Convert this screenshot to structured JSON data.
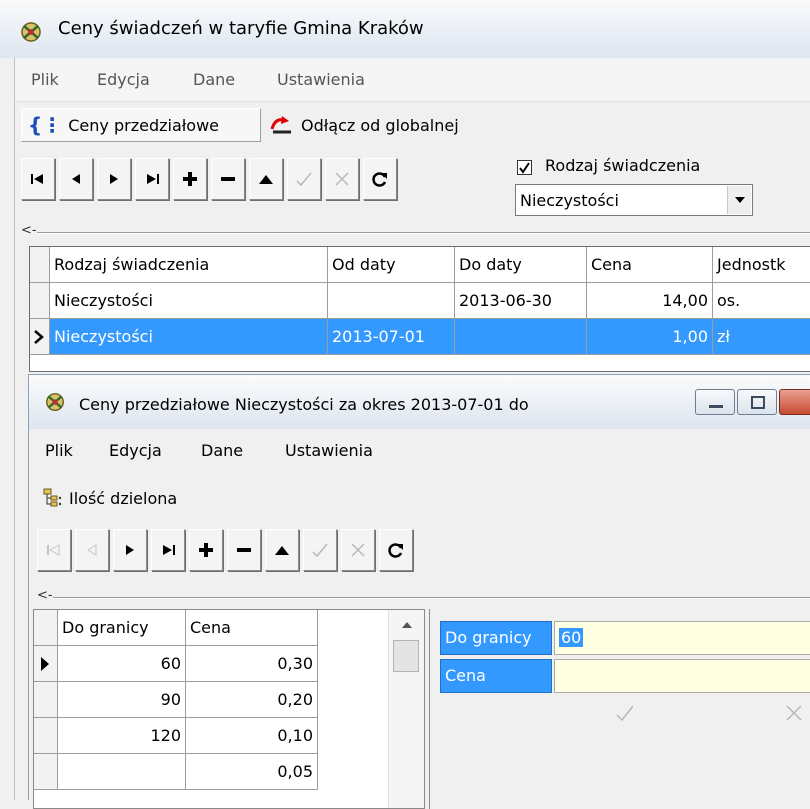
{
  "main_window": {
    "title": "Ceny świadczeń w taryfie Gmina Kraków",
    "menu": [
      "Plik",
      "Edycja",
      "Dane",
      "Ustawienia"
    ],
    "actions": {
      "price_ranges": "Ceny przedziałowe",
      "disconnect_global": "Odłącz od globalnej"
    },
    "filter": {
      "checkbox_label": "Rodzaj świadczenia",
      "checked": true,
      "combo_value": "Nieczystości"
    },
    "collapse_glyph": "<-",
    "grid": {
      "columns": [
        "Rodzaj świadczenia",
        "Od daty",
        "Do daty",
        "Cena",
        "Jednostk"
      ],
      "rows": [
        [
          "Nieczystości",
          "",
          "2013-06-30",
          "14,00",
          "os."
        ],
        [
          "Nieczystości",
          "2013-07-01",
          "",
          "1,00",
          "zł"
        ]
      ],
      "selected_row": 1
    }
  },
  "inner_window": {
    "title": "Ceny przedziałowe Nieczystości za okres 2013-07-01 do",
    "menu": [
      "Plik",
      "Edycja",
      "Dane",
      "Ustawienia"
    ],
    "actions": {
      "shared_quantity": "Ilość dzielona"
    },
    "collapse_glyph": "<-",
    "grid": {
      "columns": [
        "Do granicy",
        "Cena"
      ],
      "rows": [
        [
          "60",
          "0,30"
        ],
        [
          "90",
          "0,20"
        ],
        [
          "120",
          "0,10"
        ],
        [
          "",
          "0,05"
        ]
      ],
      "current_row": 0
    },
    "form": {
      "limit_label": "Do granicy",
      "limit_value": "60",
      "price_label": "Cena",
      "price_value": ""
    }
  },
  "colors": {
    "selection": "#3399ff",
    "input_bg": "#ffffe1",
    "accent_red": "#e00000"
  }
}
